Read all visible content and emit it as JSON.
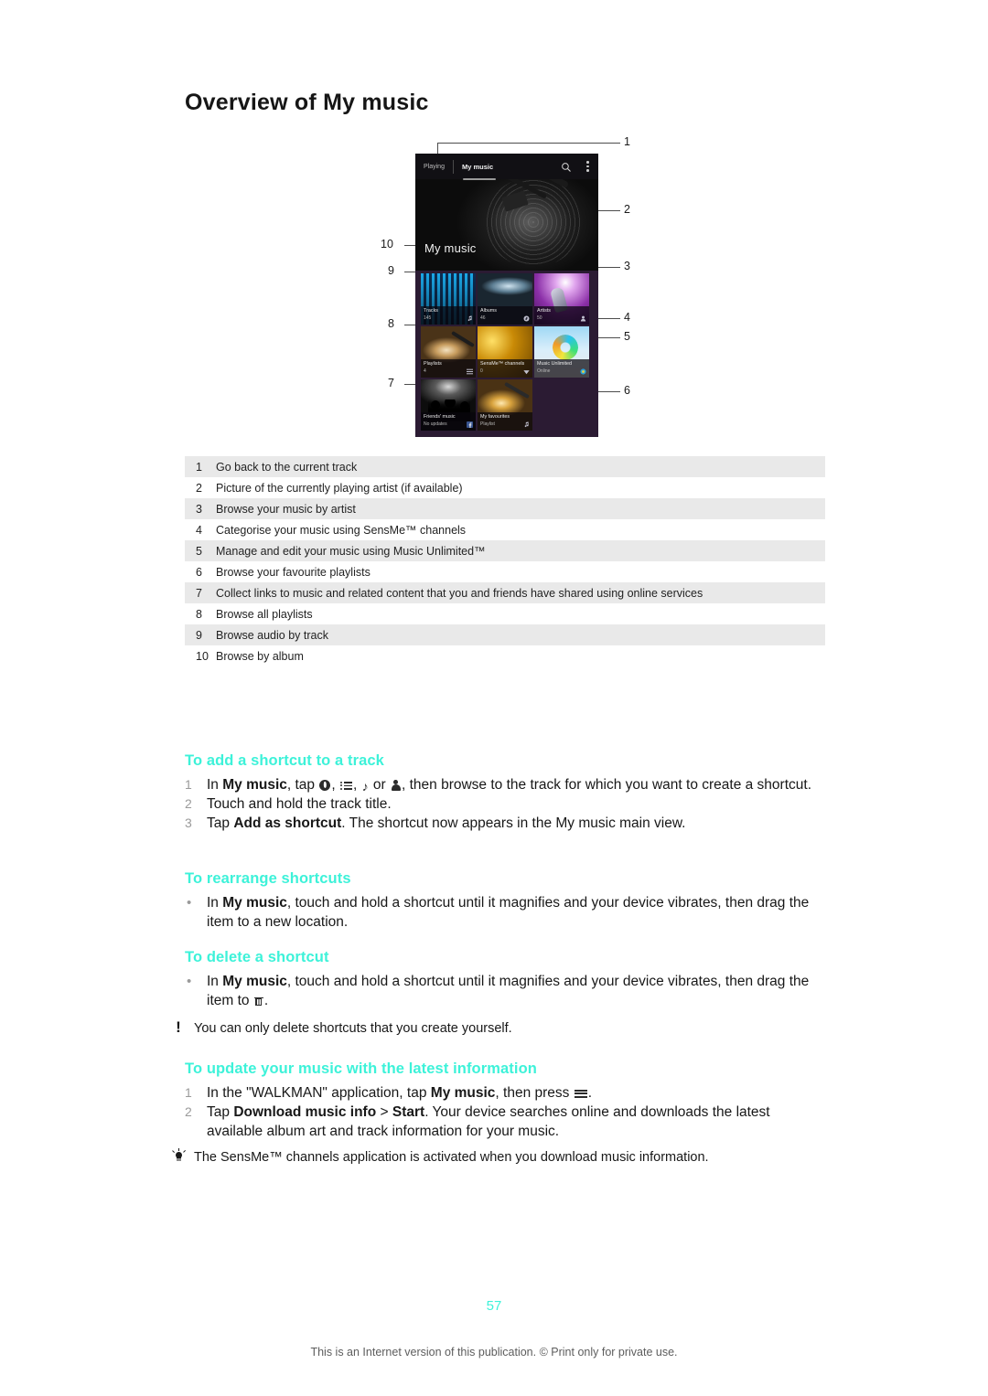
{
  "document": {
    "title": "Overview of My music",
    "page_number": "57",
    "footer": "This is an Internet version of this publication. © Print only for private use.",
    "accent_color": "#3df2d9"
  },
  "figure": {
    "alt_name": "my-music-overview-screenshot",
    "phone_ui": {
      "tab_playing": "Playing",
      "tab_my_music": "My music",
      "search_icon": "search-icon",
      "overflow_icon": "overflow-menu-icon",
      "hero_title": "My music",
      "tiles": [
        {
          "title": "Tracks",
          "subtitle": "145",
          "badge": "music-note-icon"
        },
        {
          "title": "Albums",
          "subtitle": "46",
          "badge": "disc-icon"
        },
        {
          "title": "Artists",
          "subtitle": "50",
          "badge": "person-icon"
        },
        {
          "title": "Playlists",
          "subtitle": "4",
          "badge": "list-icon"
        },
        {
          "title": "SensMe™ channels",
          "subtitle": "0",
          "badge": "wave-icon"
        },
        {
          "title": "Music Unlimited",
          "subtitle": "Online",
          "badge": "music-unlimited-icon"
        },
        {
          "title": "Friends' music",
          "subtitle": "No updates",
          "badge": "facebook-icon"
        },
        {
          "title": "My favourites",
          "subtitle": "Playlist",
          "badge": "playlist-icon"
        }
      ]
    },
    "callouts_left": [
      "10",
      "9",
      "8",
      "7"
    ],
    "callouts_right": [
      "1",
      "2",
      "3",
      "4",
      "5",
      "6"
    ]
  },
  "legend": {
    "rows": [
      {
        "num": "1",
        "text": "Go back to the current track"
      },
      {
        "num": "2",
        "text": "Picture of the currently playing artist (if available)"
      },
      {
        "num": "3",
        "text": "Browse your music by artist"
      },
      {
        "num": "4",
        "text": "Categorise your music using SensMe™ channels"
      },
      {
        "num": "5",
        "text": "Manage and edit your music using Music Unlimited™"
      },
      {
        "num": "6",
        "text": "Browse your favourite playlists"
      },
      {
        "num": "7",
        "text": "Collect links to music and related content that you and friends have shared using online services"
      },
      {
        "num": "8",
        "text": "Browse all playlists"
      },
      {
        "num": "9",
        "text": "Browse audio by track"
      },
      {
        "num": "10",
        "text": "Browse by album"
      }
    ]
  },
  "procedures": {
    "add_shortcut": {
      "heading": "To add a shortcut to a track",
      "steps": [
        {
          "num": "1",
          "parts": [
            {
              "t": "In "
            },
            {
              "t": "My music",
              "bold": true
            },
            {
              "t": ", tap "
            },
            {
              "icon": "disc-icon"
            },
            {
              "t": ", "
            },
            {
              "icon": "list-icon"
            },
            {
              "t": ", "
            },
            {
              "icon": "music-note-icon"
            },
            {
              "t": " or "
            },
            {
              "icon": "person-icon"
            },
            {
              "t": ", then browse to the track for which you want to create a shortcut."
            }
          ]
        },
        {
          "num": "2",
          "parts": [
            {
              "t": "Touch and hold the track title."
            }
          ]
        },
        {
          "num": "3",
          "parts": [
            {
              "t": "Tap "
            },
            {
              "t": "Add as shortcut",
              "bold": true
            },
            {
              "t": ". The shortcut now appears in the My music main view."
            }
          ]
        }
      ]
    },
    "rearrange_shortcuts": {
      "heading": "To rearrange shortcuts",
      "bullet": "•",
      "steps": [
        {
          "parts": [
            {
              "t": "In "
            },
            {
              "t": "My music",
              "bold": true
            },
            {
              "t": ", touch and hold a shortcut until it magnifies and your device vibrates, then drag the item to a new location."
            }
          ]
        }
      ]
    },
    "delete_shortcut": {
      "heading": "To delete a shortcut",
      "bullet": "•",
      "steps": [
        {
          "parts": [
            {
              "t": "In "
            },
            {
              "t": "My music",
              "bold": true
            },
            {
              "t": ", touch and hold a shortcut until it magnifies and your device vibrates, then drag the item to "
            },
            {
              "icon": "trash-icon"
            },
            {
              "t": "."
            }
          ]
        }
      ]
    },
    "warning_note": {
      "icon": "exclamation-icon",
      "text": "You can only delete shortcuts that you create yourself."
    },
    "update_music": {
      "heading": "To update your music with the latest information",
      "steps": [
        {
          "num": "1",
          "parts": [
            {
              "t": "In the \"WALKMAN\" application, tap "
            },
            {
              "t": "My music",
              "bold": true
            },
            {
              "t": ", then press "
            },
            {
              "icon": "menu-icon"
            },
            {
              "t": "."
            }
          ]
        },
        {
          "num": "2",
          "parts": [
            {
              "t": "Tap "
            },
            {
              "t": "Download music info",
              "bold": true
            },
            {
              "t": " > "
            },
            {
              "t": "Start",
              "bold": true
            },
            {
              "t": ". Your device searches online and downloads the latest available album art and track information for your music."
            }
          ]
        }
      ]
    },
    "tip_note": {
      "icon": "lightbulb-icon",
      "text": "The SensMe™ channels application is activated when you download music information."
    }
  }
}
